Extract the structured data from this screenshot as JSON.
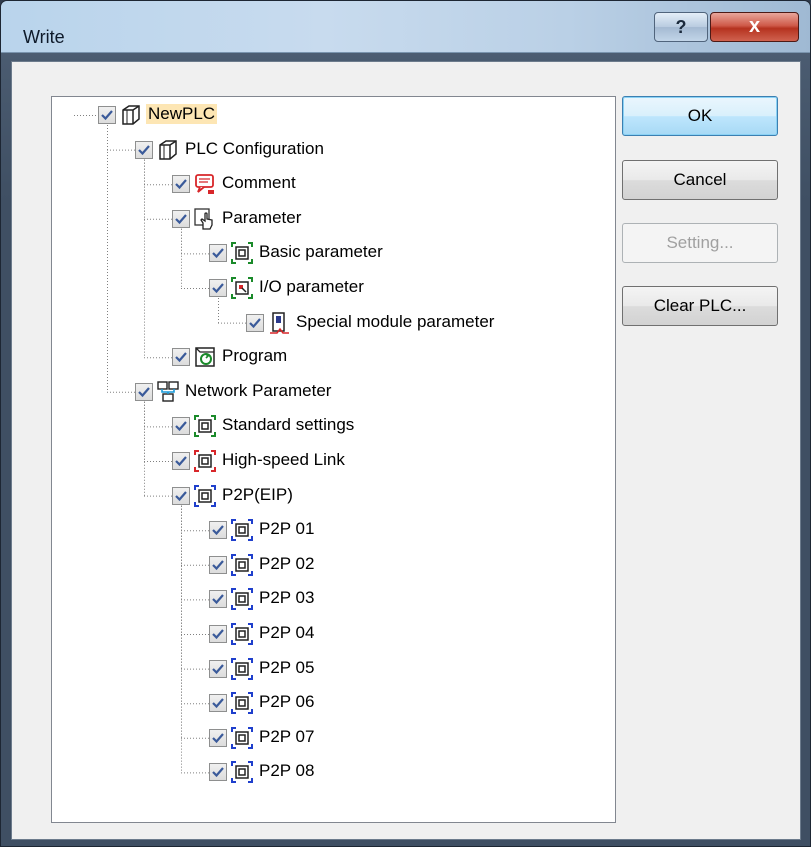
{
  "window": {
    "title": "Write"
  },
  "titlebar": {
    "help_label": "?",
    "close_label": "x"
  },
  "buttons": {
    "ok": "OK",
    "cancel": "Cancel",
    "setting": "Setting...",
    "clear_plc": "Clear PLC..."
  },
  "tree": [
    {
      "label": "NewPLC",
      "level": 0,
      "icon": "plc-cube-icon",
      "checked": true,
      "selected": true
    },
    {
      "label": "PLC Configuration",
      "level": 1,
      "icon": "plc-cube-icon",
      "checked": true
    },
    {
      "label": "Comment",
      "level": 2,
      "icon": "comment-icon",
      "checked": true
    },
    {
      "label": "Parameter",
      "level": 2,
      "icon": "hand-pointer-icon",
      "checked": true
    },
    {
      "label": "Basic parameter",
      "level": 3,
      "icon": "basic-parameter-icon",
      "checked": true
    },
    {
      "label": "I/O parameter",
      "level": 3,
      "icon": "io-parameter-icon",
      "checked": true
    },
    {
      "label": "Special module parameter",
      "level": 4,
      "icon": "special-module-icon",
      "checked": true
    },
    {
      "label": "Program",
      "level": 2,
      "icon": "program-icon",
      "checked": true
    },
    {
      "label": "Network Parameter",
      "level": 1,
      "icon": "network-icon",
      "checked": true
    },
    {
      "label": "Standard settings",
      "level": 2,
      "icon": "standard-settings-icon",
      "checked": true
    },
    {
      "label": "High-speed Link",
      "level": 2,
      "icon": "high-speed-link-icon",
      "checked": true
    },
    {
      "label": "P2P(EIP)",
      "level": 2,
      "icon": "p2p-icon",
      "checked": true
    },
    {
      "label": "P2P 01",
      "level": 3,
      "icon": "p2p-icon",
      "checked": true
    },
    {
      "label": "P2P 02",
      "level": 3,
      "icon": "p2p-icon",
      "checked": true
    },
    {
      "label": "P2P 03",
      "level": 3,
      "icon": "p2p-icon",
      "checked": true
    },
    {
      "label": "P2P 04",
      "level": 3,
      "icon": "p2p-icon",
      "checked": true
    },
    {
      "label": "P2P 05",
      "level": 3,
      "icon": "p2p-icon",
      "checked": true
    },
    {
      "label": "P2P 06",
      "level": 3,
      "icon": "p2p-icon",
      "checked": true
    },
    {
      "label": "P2P 07",
      "level": 3,
      "icon": "p2p-icon",
      "checked": true
    },
    {
      "label": "P2P 08",
      "level": 3,
      "icon": "p2p-icon",
      "checked": true
    }
  ],
  "colors": {
    "selection": "#fde6b4",
    "check": "#3a5a9a"
  }
}
